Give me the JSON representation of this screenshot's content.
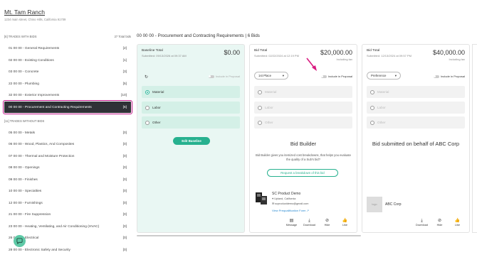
{
  "project": {
    "title": "Mt. Tam Ranch",
    "address": "1234 main street, Chino Hills, California 91709"
  },
  "sidebar": {
    "with_bids_header": "[6] TRADES WITH BIDS",
    "total_bids": "27 Total bids",
    "trades_with_bids": [
      {
        "label": "01 00 00 - General Requirements",
        "count": "[2]"
      },
      {
        "label": "02 00 00 - Existing Conditions",
        "count": "[1]"
      },
      {
        "label": "03 00 00 - Concrete",
        "count": "[3]"
      },
      {
        "label": "22 00 00 - Plumbing",
        "count": "[5]"
      },
      {
        "label": "32 00 00 - Exterior Improvements",
        "count": "[10]"
      },
      {
        "label": "00 00 00 - Procurement and Contracting Requirements",
        "count": "[6]"
      }
    ],
    "without_bids_header": "[11] TRADES WITHOUT BIDS",
    "trades_without_bids": [
      {
        "label": "05 00 00 - Metals",
        "count": "[0]"
      },
      {
        "label": "06 00 00 - Wood, Plastics, And Composites",
        "count": "[0]"
      },
      {
        "label": "07 00 00 - Thermal and Moisture Protection",
        "count": "[0]"
      },
      {
        "label": "08 00 00 - Openings",
        "count": "[0]"
      },
      {
        "label": "09 00 00 - Finishes",
        "count": "[0]"
      },
      {
        "label": "10 00 00 - Specialties",
        "count": "[0]"
      },
      {
        "label": "12 00 00 - Furnishings",
        "count": "[0]"
      },
      {
        "label": "21 00 00 - Fire Suppression",
        "count": "[0]"
      },
      {
        "label": "23 00 00 - Heating, Ventilating, and Air Conditioning (HVAC)",
        "count": "[0]"
      },
      {
        "label": "26 00 00 - Electrical",
        "count": "[0]"
      },
      {
        "label": "28 00 00 - Electronic Safety and Security",
        "count": "[0]"
      }
    ]
  },
  "main": {
    "title": "00 00 00 - Procurement and Contracting Requirements | 6 Bids",
    "include_in_proposal": "Include in Proposal",
    "options": [
      "Material",
      "Labor",
      "Other"
    ],
    "baseline": {
      "title": "Baseline Total",
      "amount": "$0.00",
      "submitted": "Submitted: 09/13/2026 at 09:37 AM",
      "edit_button": "Edit Baseline"
    },
    "bid1": {
      "title": "Bid Total",
      "amount": "$20,000.00",
      "tax": "Including tax",
      "submitted": "Submitted: 02/22/2024 at 12:19 PM",
      "place": "1st Place",
      "heading": "Bid Builder",
      "description": "Bid Builder gives you itemized cost breakdowns, that helps you evaluate the quality of a Sub's bid?",
      "request_button": "Request a breakdown of this bid",
      "vendor": {
        "name": "SC Product Demo",
        "location": "Upland, California",
        "email": "scproductdemo@gmail.com",
        "link": "View Prequalification Form"
      },
      "actions": [
        "Message",
        "Download",
        "Hide",
        "Like"
      ]
    },
    "bid2": {
      "title": "Bid Total",
      "amount": "$40,000.00",
      "tax": "Including tax",
      "submitted": "Submitted: 12/13/2024 at 09:57 PM",
      "place": "Preference",
      "heading": "Bid submitted on behalf of ABC Corp",
      "logo_text": "logo",
      "vendor_name": "ABC Corp",
      "actions": [
        "Download",
        "Hide",
        "Like"
      ]
    }
  },
  "colors": {
    "accent": "#27b18f",
    "highlight": "#c2188b",
    "active_bg": "#2f3136",
    "baseline_bg": "#e9f7f3"
  }
}
